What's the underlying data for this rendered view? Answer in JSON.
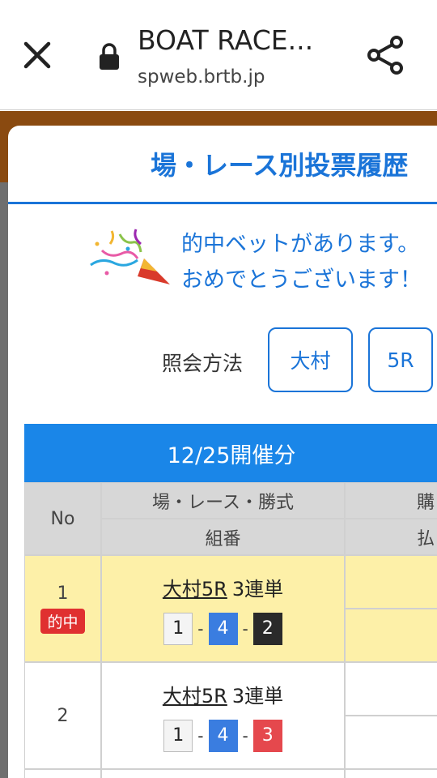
{
  "browser": {
    "title": "BOAT RACE...",
    "url": "spweb.brtb.jp"
  },
  "modal": {
    "title": "場・レース別投票履歴",
    "hit_message_line1": "的中ベットがあります。",
    "hit_message_line2": "おめでとうございます！",
    "query_label": "照会方法",
    "query_venue": "大村",
    "query_race": "5R"
  },
  "table": {
    "date_header": "12/25開催分",
    "col_no": "No",
    "col_race_top": "場・レース・勝式",
    "col_race_bottom": "組番",
    "col_buy_top": "購",
    "col_buy_bottom": "払",
    "rows": [
      {
        "no": "1",
        "badge": "的中",
        "race": "大村5R",
        "type": "3連単",
        "combo": [
          "1",
          "4",
          "2"
        ],
        "dash": "-"
      },
      {
        "no": "2",
        "race": "大村5R",
        "type": "3連単",
        "combo": [
          "1",
          "4",
          "3"
        ],
        "dash": "-"
      }
    ]
  },
  "colors": {
    "accent": "#1a74d8",
    "header_blue": "#1a86e8",
    "hit_row": "#fdf0a8",
    "badge_red": "#e03030"
  }
}
